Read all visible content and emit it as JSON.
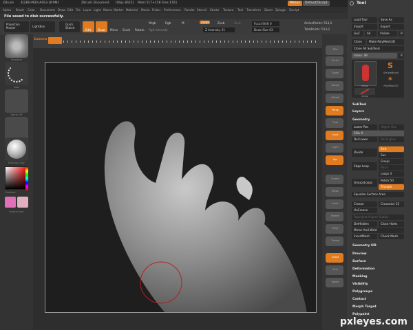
{
  "titlebar": {
    "app": "ZBrush",
    "build": "4[ZB0-PKDI-A0E3-QF9M]",
    "document": "ZBrush Document",
    "objs": "[Objs 8625]",
    "mem": "Mem:517+158",
    "free": "Free:1761",
    "menus_btn": "Menus",
    "script_btn": "DefaultZScript"
  },
  "menubar": [
    "Alpha",
    "Brush",
    "Color",
    "Document",
    "Draw",
    "Edit",
    "File",
    "Layer",
    "Light",
    "Macro",
    "Marker",
    "Material",
    "Movie",
    "Picker",
    "Preferences",
    "Render",
    "Stencil",
    "Stroke",
    "Texture",
    "Tool",
    "Transform",
    "Zoom",
    "Zplugin",
    "Zscript"
  ],
  "status": "File saved to disk successfully.",
  "toolbar": {
    "projection_master": "Projection Master",
    "lightbox": "LightBox",
    "quick_sketch": "Quick Sketch",
    "edit": "Edit",
    "draw": "Draw",
    "move": "Move",
    "scale": "Scale",
    "rotate": "Rotate",
    "mrgb": "Mrgb",
    "rgb": "Rgb",
    "m": "M",
    "rgb_intensity": "Rgb Intensity",
    "zadd": "Zadd",
    "zsub": "Zsub",
    "zcut": "Zcut",
    "z_intensity": "Z Intensity 31",
    "focal_shift": "Focal Shift 0",
    "draw_size": "Draw Size 63",
    "active_points": "ActivePoints: 513,2",
    "total_points": "TotalPoints: 513,2"
  },
  "ruler": {
    "label": "Camera"
  },
  "leftpanel": {
    "thumbs": [
      "Standard",
      "Dots",
      "Alpha Off",
      "Texture Off",
      "MatCap Gray"
    ],
    "gradient": "Gradient",
    "switchcolor": "SwitchColor"
  },
  "shelf": [
    "SPix",
    "Scroll",
    "Zoom",
    "Actual",
    "AAHalf",
    "Persp",
    "Floor",
    "Local",
    "LSym",
    "Xyz",
    "Frame",
    "Move",
    "Scale",
    "Rotate",
    "PolyF",
    "Transp",
    "Ghost",
    "Solo",
    "Xpose"
  ],
  "rightpanel": {
    "title": "Tool",
    "load_tool": "Load Tool",
    "save_as": "Save As",
    "import": "Import",
    "export": "Export",
    "goz": "GoZ",
    "all": "All",
    "visible": "Visible",
    "r": "R",
    "clone": "Clone",
    "make_polymesh": "Make PolyMesh3D",
    "clone_all": "Clone All SubTools",
    "tool_name": "mano. 48",
    "tool_r": "R",
    "simple_brush": "SimpleBrush",
    "polymesh3d": "PolyMesh3D",
    "thumb1": "mano",
    "thumb2": "mano",
    "subtool": "SubTool",
    "layers": "Layers",
    "geometry": "Geometry",
    "lower_res": "Lower Res",
    "higher_res": "Higher Res",
    "sdiv": "SDiv 6",
    "del_lower": "Del Lower",
    "del_higher": "Del Higher",
    "divide": "Divide",
    "smt": "Smt",
    "suv": "Suv",
    "edge_loop": "Edge Loop",
    "group": "Group",
    "rsuv": "RSuv",
    "groupsloops": "GroupsLoops",
    "loops": "Loops 4",
    "polish": "Polish 50",
    "triangle": "Triangle",
    "equalize": "Equalize Surface Area",
    "crease": "Crease",
    "creaselvl": "CreaseLvl 15",
    "uncrease": "UnCrease",
    "reproject": "Reproject Higher Subdiv",
    "delhidden": "DelHidden",
    "close_holes": "Close Holes",
    "mirror_weld": "Mirror And Weld",
    "insert_mesh": "InsertMesh",
    "check_mesh": "Check Mesh",
    "sections": [
      "Geometry HD",
      "Preview",
      "Surface",
      "Deformation",
      "Masking",
      "Visibility",
      "Polygroups",
      "Contact",
      "Morph Target",
      "Polypaint"
    ]
  },
  "watermark": "pxleyes.com",
  "colors": {
    "accent": "#e07b1f",
    "panel": "#3a3a3a",
    "canvas": "#1e1e1e"
  }
}
